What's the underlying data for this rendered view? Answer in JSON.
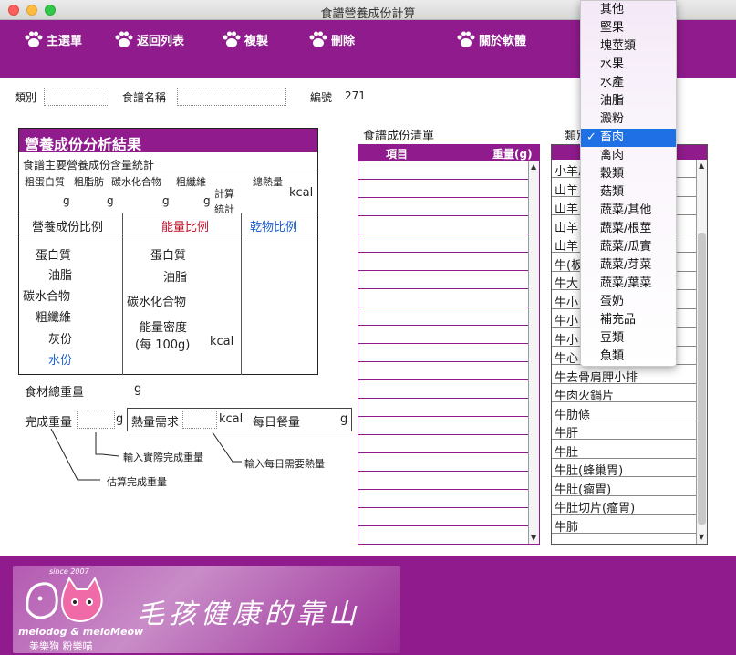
{
  "window": {
    "title": "食譜營養成份計算"
  },
  "toolbar": {
    "main_menu": "主選單",
    "back_to_list": "返回列表",
    "copy": "複製",
    "delete": "刪除",
    "about": "關於軟體"
  },
  "form": {
    "category_label": "類別",
    "category_value": "",
    "recipe_name_label": "食譜名稱",
    "recipe_name_value": "",
    "number_label": "編號",
    "number_value": "271"
  },
  "analysis": {
    "title": "營養成份分析結果",
    "subtitle": "食譜主要營養成份含量統計",
    "cols": [
      "粗蛋白質",
      "粗脂肪",
      "碳水化合物",
      "粗纖維"
    ],
    "unit_g": "g",
    "total_calories": "總熱量",
    "kcal": "kcal",
    "calc_stats_1": "計算",
    "calc_stats_2": "統計",
    "section_ratio": "營養成份比例",
    "section_energy": "能量比例",
    "section_dry": "乾物比例",
    "left_items": [
      "蛋白質",
      "油脂",
      "碳水合物",
      "粗纖維",
      "灰份",
      "水份"
    ],
    "mid_items": [
      "蛋白質",
      "油脂",
      "碳水化合物"
    ],
    "energy_density": "能量密度",
    "per_100g": "(每 100g)",
    "energy_unit": "kcal"
  },
  "weights": {
    "total_weight_label": "食材總重量",
    "total_weight_unit": "g",
    "finished_weight_label": "完成重量",
    "finished_weight_unit": "g",
    "calorie_need_label": "熱量需求",
    "calorie_need_unit": "kcal",
    "daily_meal_label": "每日餐量",
    "daily_meal_unit": "g"
  },
  "annotations": {
    "input_actual": "輸入實際完成重量",
    "input_daily": "輸入每日需要熱量",
    "estimate": "估算完成重量"
  },
  "ingredients_list": {
    "title": "食譜成份清單",
    "col_item": "項目",
    "col_weight": "重量(g)"
  },
  "material_list": {
    "header_label": "類別",
    "rows": [
      "小羊肩",
      "山羊",
      "山羊",
      "山羊",
      "山羊",
      "牛(板",
      "牛大",
      "牛小",
      "牛小",
      "牛小",
      "牛心",
      "牛去骨肩胛小排",
      "牛肉火鍋片",
      "牛肋條",
      "牛肝",
      "牛肚",
      "牛肚(蜂巢胃)",
      "牛肚(瘤胃)",
      "牛肚切片(瘤胃)",
      "牛肺"
    ]
  },
  "dropdown": {
    "items": [
      "其他",
      "堅果",
      "塊莖類",
      "水果",
      "水產",
      "油脂",
      "澱粉",
      "畜肉",
      "禽肉",
      "穀類",
      "菇類",
      "蔬菜/其他",
      "蔬菜/根莖",
      "蔬菜/瓜實",
      "蔬菜/芽菜",
      "蔬菜/葉菜",
      "蛋奶",
      "補充品",
      "豆類",
      "魚類"
    ],
    "selected": "畜肉",
    "check": "✓"
  },
  "footer": {
    "since": "since 2007",
    "brand_en": "melodog & meloMeow",
    "brand_zh": "美樂狗 粉樂喵",
    "slogan": "毛孩健康的靠山"
  },
  "colors": {
    "brand": "#8f1b8c",
    "highlight": "#1f6fe5",
    "blue_text": "#1a5fd0",
    "red_text": "#c0102a"
  }
}
